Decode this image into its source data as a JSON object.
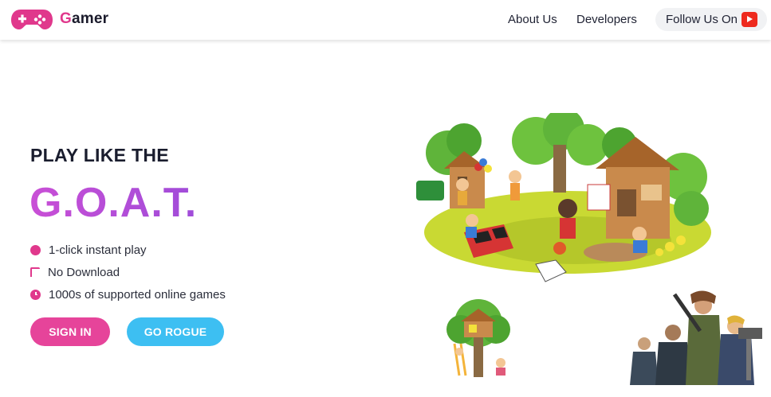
{
  "brand": {
    "first_letter": "G",
    "rest": "amer"
  },
  "nav": {
    "about": "About Us",
    "developers": "Developers",
    "follow": "Follow Us On"
  },
  "hero": {
    "pre_title": "PLAY LIKE THE",
    "title": "G.O.A.T.",
    "features": [
      {
        "icon": "circle-icon",
        "text": "1-click instant play"
      },
      {
        "icon": "download-icon",
        "text": "No Download"
      },
      {
        "icon": "clock-icon",
        "text": "1000s of supported online games"
      }
    ],
    "signin_label": "SIGN IN",
    "rogue_label": "GO ROGUE"
  },
  "colors": {
    "pink": "#e6449a",
    "purple": "#b04fd8",
    "blue": "#3dbff2",
    "youtube": "#ee2a1e"
  }
}
